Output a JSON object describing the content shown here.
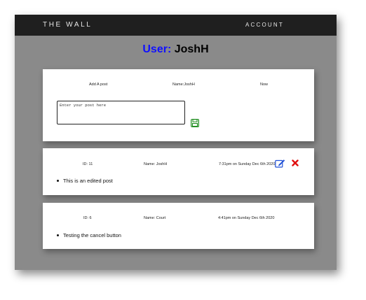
{
  "nav": {
    "brand": "THE WALL",
    "account_label": "ACCOUNT"
  },
  "user": {
    "label": "User:",
    "name": "JoshH"
  },
  "add_post": {
    "title": "Add A post",
    "name": "Name:JoshH",
    "time": "Now",
    "placeholder": "Enter your post here",
    "save_icon": "save-icon"
  },
  "posts": [
    {
      "id": "ID: 11",
      "name": "Name: JoshH",
      "time": "7:31pm on Sunday Dec 6th 2020",
      "body": "This is an edited post",
      "edit_icon": "edit-icon",
      "delete_icon": "delete-icon"
    },
    {
      "id": "ID: 6",
      "name": "Name: Court",
      "time": "4:41pm on Sunday Dec 6th 2020",
      "body": "Testing the cancel button"
    }
  ],
  "colors": {
    "nav_bg": "#1f1f1f",
    "page_bg": "#8a8a8a",
    "user_label": "#1010ff",
    "save": "#1a8a1a",
    "edit": "#1f4fd6",
    "delete": "#e01010"
  }
}
